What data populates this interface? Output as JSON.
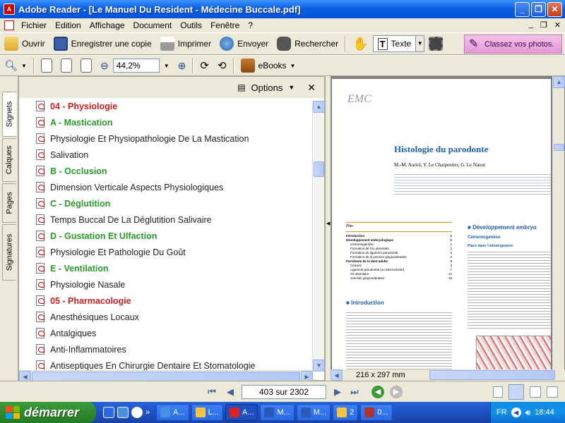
{
  "window": {
    "title": "Adobe Reader - [Le Manuel Du Resident - Médecine Buccale.pdf]"
  },
  "menu": [
    "Fichier",
    "Edition",
    "Affichage",
    "Document",
    "Outils",
    "Fenêtre",
    "?"
  ],
  "toolbar": {
    "open": "Ouvrir",
    "save_copy": "Enregistrer une copie",
    "print": "Imprimer",
    "send": "Envoyer",
    "search": "Rechercher",
    "text_tool": "Texte",
    "promo": "Classez vos photos.",
    "zoom": "44,2%",
    "ebooks": "eBooks"
  },
  "side_tabs": [
    "Signets",
    "Calques",
    "Pages",
    "Signatures"
  ],
  "bookmarks": {
    "options_label": "Options",
    "items": [
      {
        "label": "04 - Physiologie",
        "style": "red"
      },
      {
        "label": "A - Mastication",
        "style": "green"
      },
      {
        "label": "Physiologie Et Physiopathologie De La Mastication",
        "style": "black"
      },
      {
        "label": "Salivation",
        "style": "black"
      },
      {
        "label": "B - Occlusion",
        "style": "green"
      },
      {
        "label": "Dimension Verticale Aspects Physiologiques",
        "style": "black"
      },
      {
        "label": "C - Déglutition",
        "style": "green"
      },
      {
        "label": "Temps Buccal De La Déglutition Salivaire",
        "style": "black"
      },
      {
        "label": "D - Gustation Et Ulfaction",
        "style": "green"
      },
      {
        "label": "Physiologie Et Pathologie Du Goût",
        "style": "black"
      },
      {
        "label": "E - Ventilation",
        "style": "green"
      },
      {
        "label": "Physiologie Nasale",
        "style": "black"
      },
      {
        "label": "05 - Pharmacologie",
        "style": "red"
      },
      {
        "label": "Anesthésiques Locaux",
        "style": "black"
      },
      {
        "label": "Antalgiques",
        "style": "black"
      },
      {
        "label": "Anti-Inflammatoires",
        "style": "black"
      },
      {
        "label": "Antiseptiques En Chirurgie Dentaire Et Stomatologie",
        "style": "black"
      }
    ]
  },
  "document": {
    "title": "Histologie du parodonte",
    "authors": "M.-M. Auriol, Y. Le Charpentier, G. Le Naour",
    "page_size": "216 x 297 mm",
    "plan_heading": "Plan",
    "toc": [
      {
        "t": "Introduction",
        "p": "1"
      },
      {
        "t": "Développement embryologique",
        "p": "1"
      },
      {
        "t": "Cémentogenèse",
        "p": "1"
      },
      {
        "t": "Formation de l'os alvéolaire",
        "p": "2"
      },
      {
        "t": "Formation du ligament parodontal",
        "p": "2"
      },
      {
        "t": "Formation de la jonction gingivodentaire",
        "p": "2"
      },
      {
        "t": "Parodonte de la dent adulte",
        "p": "3"
      },
      {
        "t": "Cément",
        "p": "3"
      },
      {
        "t": "Ligament parodontal (ou desmodonte)",
        "p": "7"
      },
      {
        "t": "Os alvéolaire",
        "p": "14"
      },
      {
        "t": "Jonction gingivodentaire",
        "p": "18"
      }
    ],
    "intro_heading": "Introduction",
    "right_heading": "Développement embryo",
    "sub1": "Cémentogenèse",
    "sub2": "Place dans l'odontogenèse"
  },
  "status": {
    "page": "403 sur 2302"
  },
  "taskbar": {
    "start": "démarrer",
    "tasks": [
      {
        "label": "A...",
        "active": false
      },
      {
        "label": "L...",
        "active": false
      },
      {
        "label": "A...",
        "active": true
      },
      {
        "label": "M...",
        "active": false
      },
      {
        "label": "M...",
        "active": false
      },
      {
        "label": "2",
        "active": false
      },
      {
        "label": "0...",
        "active": false
      }
    ],
    "lang": "FR",
    "clock": "18:44"
  },
  "colors": {
    "bookmark_red": "#cc1f1f",
    "bookmark_green": "#2a9a2a",
    "doc_title_blue": "#1f5fae",
    "taskbar_blue": "#245edb",
    "start_green": "#3c9a3c"
  }
}
